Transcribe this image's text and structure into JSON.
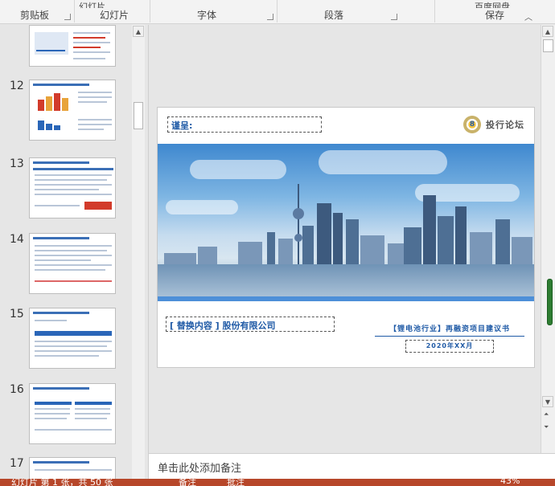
{
  "ribbon": {
    "top_partial": "幻灯片",
    "top_partial_right": "百度网盘",
    "groups": {
      "clipboard": "剪贴板",
      "slides": "幻灯片",
      "font": "字体",
      "paragraph": "段落",
      "save": "保存"
    }
  },
  "thumbnails": {
    "slides": [
      {
        "number": "12"
      },
      {
        "number": "13"
      },
      {
        "number": "14"
      },
      {
        "number": "15"
      },
      {
        "number": "16"
      },
      {
        "number": "17"
      }
    ]
  },
  "slide": {
    "presented_to": "谨呈:",
    "logo_mark": "8",
    "logo_text": "投行论坛",
    "company": "[ 替换内容 ] 股份有限公司",
    "report_title": "【锂电池行业】再融资项目建议书",
    "date": "2020年XX月"
  },
  "notes": {
    "placeholder": "单击此处添加备注"
  },
  "status_bar": {
    "slide_info": "幻灯片 第 1 张，共 50 张",
    "notes_button": "备注",
    "comments_button": "批注",
    "zoom": "43%"
  }
}
